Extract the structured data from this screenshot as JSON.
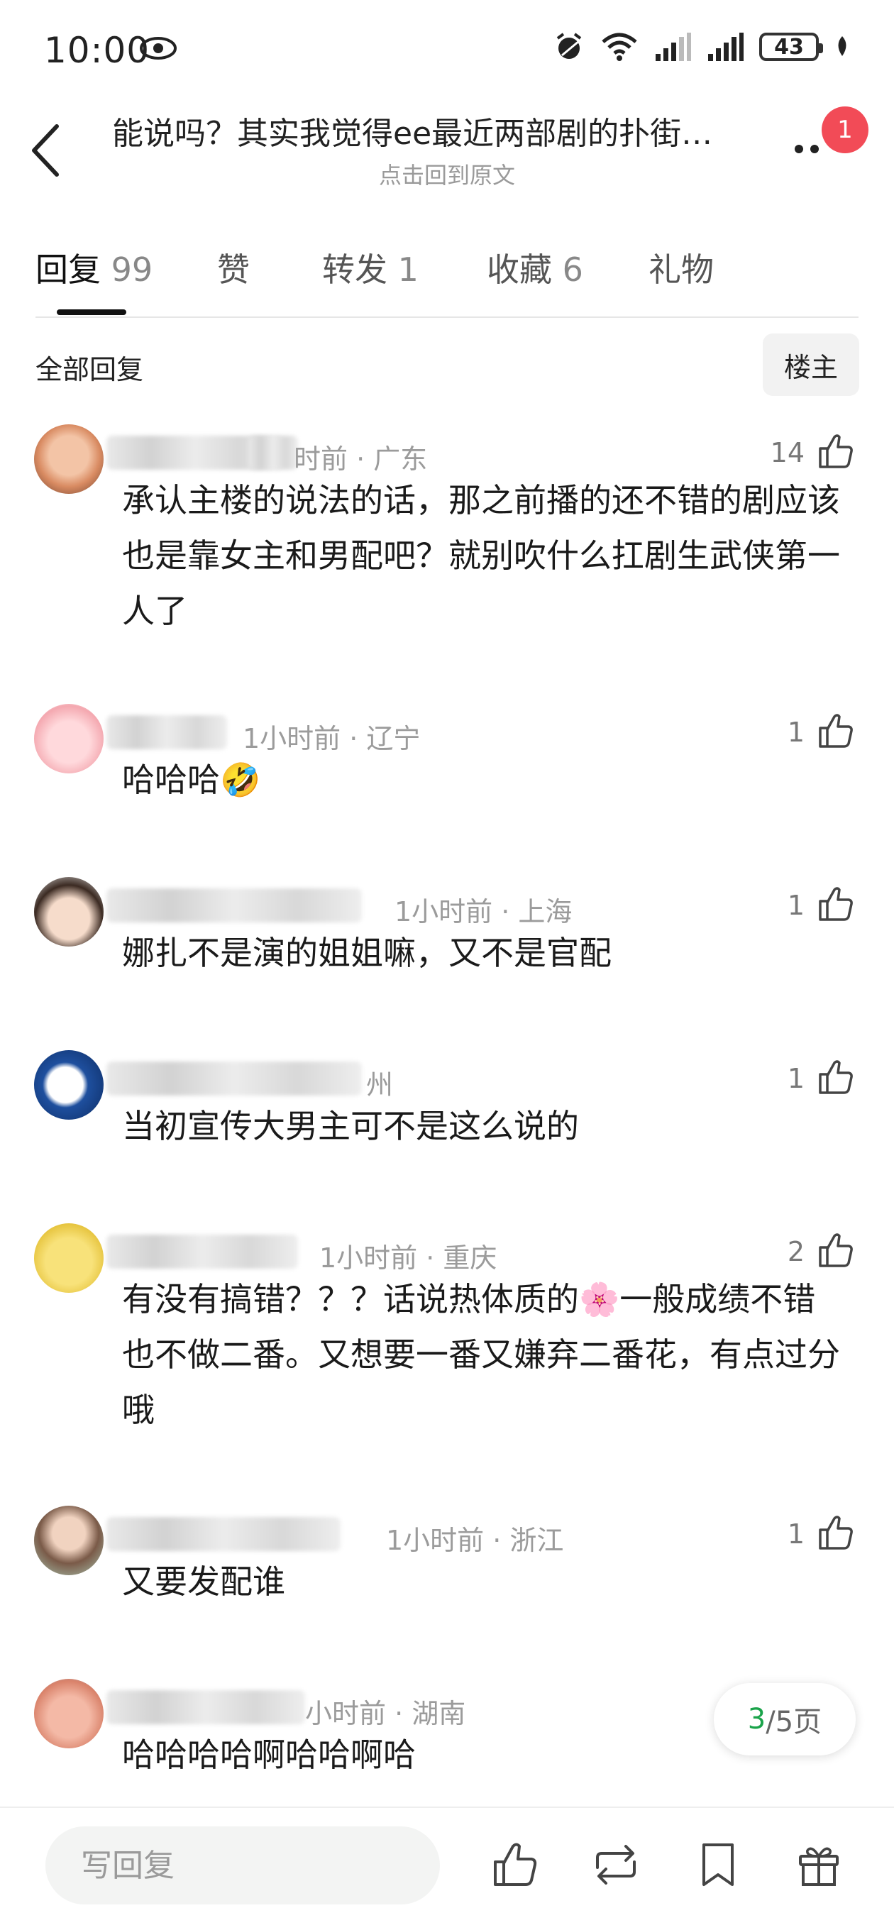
{
  "status_bar": {
    "time": "10:00",
    "battery": "43"
  },
  "header": {
    "title": "能说吗？其实我觉得ee最近两部剧的扑街…",
    "subtitle": "点击回到原文",
    "notification_count": "1"
  },
  "tabs": [
    {
      "label": "回复",
      "count": "99"
    },
    {
      "label": "赞",
      "count": ""
    },
    {
      "label": "转发",
      "count": "1"
    },
    {
      "label": "收藏",
      "count": "6"
    },
    {
      "label": "礼物",
      "count": ""
    }
  ],
  "section": {
    "label": "全部回复",
    "filter_button": "楼主"
  },
  "comments": [
    {
      "meta": "时前 · 广东",
      "likes": "14",
      "text": "承认主楼的说法的话，那之前播的还不错的剧应该也是靠女主和男配吧？就别吹什么扛剧生武侠第一人了"
    },
    {
      "meta": "1小时前 · 辽宁",
      "likes": "1",
      "text": "哈哈哈🤣"
    },
    {
      "meta": "1小时前 · 上海",
      "likes": "1",
      "text": "娜扎不是演的姐姐嘛，又不是官配"
    },
    {
      "meta": "州",
      "likes": "1",
      "text": "当初宣传大男主可不是这么说的"
    },
    {
      "meta": "1小时前 · 重庆",
      "likes": "2",
      "text": "有没有搞错？？？话说热体质的🌸一般成绩不错也不做二番。又想要一番又嫌弃二番花，有点过分哦"
    },
    {
      "meta": "1小时前 · 浙江",
      "likes": "1",
      "text": "又要发配谁"
    },
    {
      "meta": "小时前 · 湖南",
      "likes": "",
      "text": "哈哈哈哈啊哈哈啊哈"
    }
  ],
  "pagination": {
    "current": "3",
    "total": "/5页"
  },
  "bottom_bar": {
    "reply_placeholder": "写回复"
  },
  "colors": {
    "accent_green": "#1aa34a",
    "badge_red": "#f24b57"
  }
}
